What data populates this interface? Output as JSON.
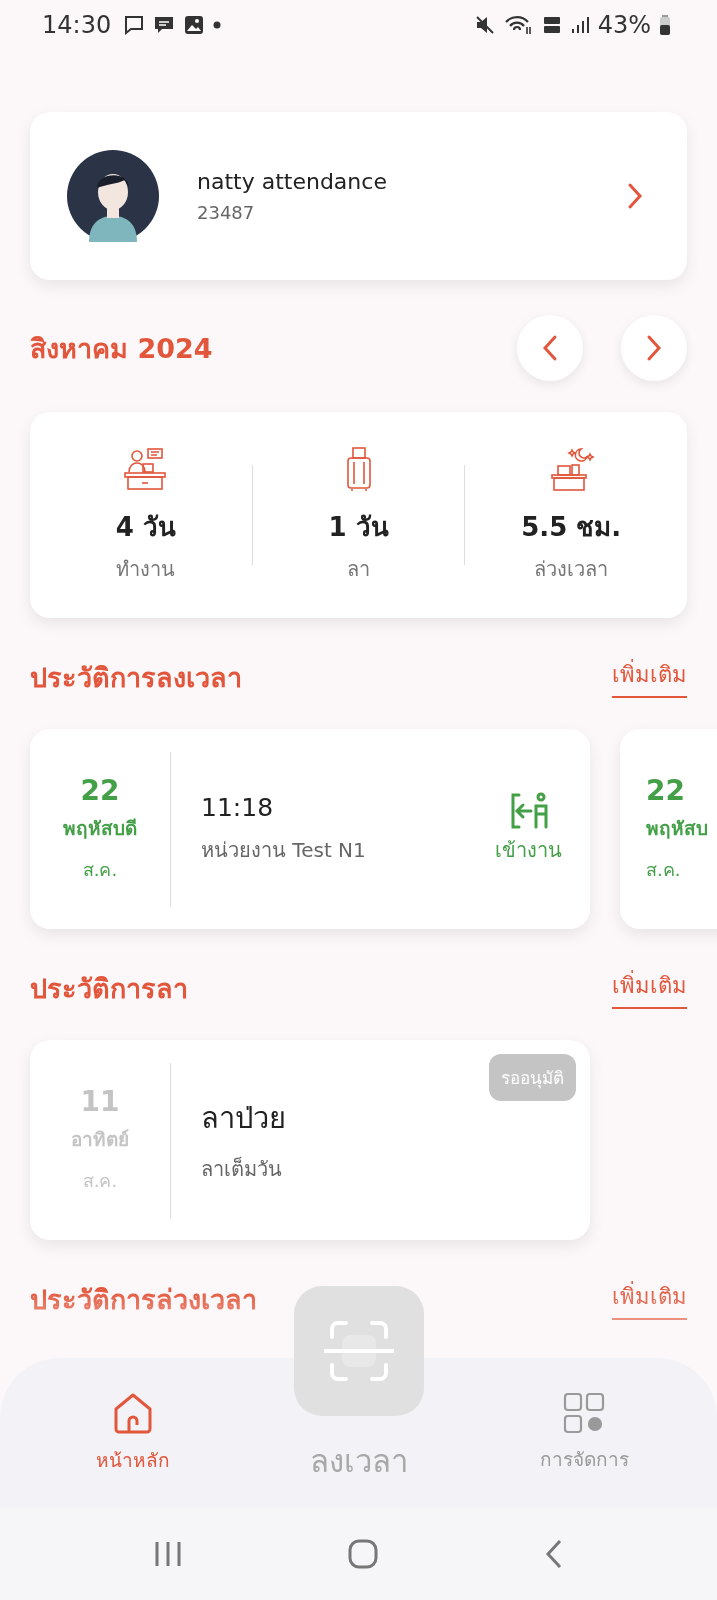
{
  "status_bar": {
    "time": "14:30",
    "battery": "43%"
  },
  "profile": {
    "name": "natty attendance",
    "id": "23487"
  },
  "month": {
    "title": "สิงหาคม 2024"
  },
  "summary": [
    {
      "kind": "work",
      "value": "4 วัน",
      "label": "ทำงาน"
    },
    {
      "kind": "leave",
      "value": "1 วัน",
      "label": "ลา"
    },
    {
      "kind": "overtime",
      "value": "5.5 ชม.",
      "label": "ล่วงเวลา"
    }
  ],
  "attendance": {
    "title": "ประวัติการลงเวลา",
    "more": "เพิ่มเติม",
    "records": [
      {
        "day": "22",
        "weekday": "พฤหัสบดี",
        "month": "ส.ค.",
        "time": "11:18",
        "place": "หน่วยงาน Test N1",
        "action": "เข้างาน",
        "kind": "check_in"
      }
    ],
    "next": {
      "day": "22",
      "weekday": "พฤหัสบ",
      "month": "ส.ค."
    }
  },
  "leave": {
    "title": "ประวัติการลา",
    "more": "เพิ่มเติม",
    "records": [
      {
        "day": "11",
        "weekday": "อาทิตย์",
        "month": "ส.ค.",
        "type": "ลาป่วย",
        "duration": "ลาเต็มวัน",
        "status": "รออนุมัติ",
        "kind": "pending"
      }
    ]
  },
  "overtime": {
    "title": "ประวัติการล่วงเวลา",
    "more": "เพิ่มเติม"
  },
  "nav": [
    {
      "kind": "home",
      "label": "หน้าหลัก",
      "selected": true
    },
    {
      "kind": "scan",
      "label": "ลงเวลา",
      "selected": false
    },
    {
      "kind": "manage",
      "label": "การจัดการ",
      "selected": false
    }
  ]
}
